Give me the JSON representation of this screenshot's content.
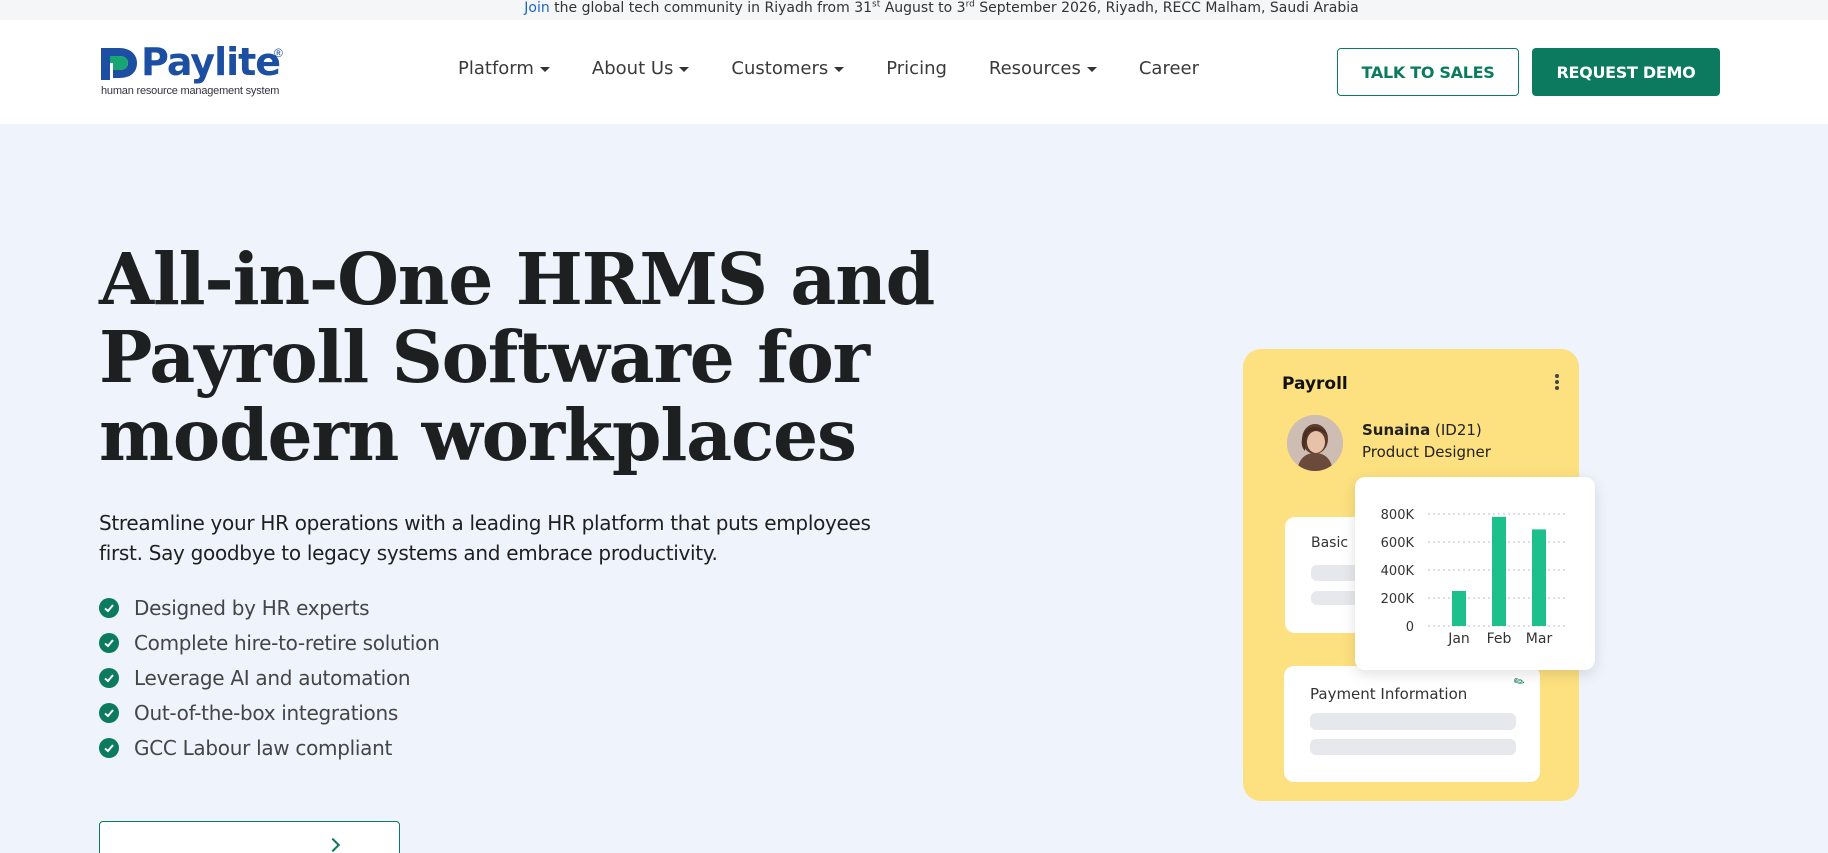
{
  "announcement": {
    "link": "Join",
    "text_a": " the global tech community in Riyadh from 31",
    "sup_a": "st",
    "text_b": " August to 3",
    "sup_b": "rd",
    "text_c": " September 2026, Riyadh, RECC Malham, Saudi Arabia"
  },
  "header": {
    "logo_text": "Paylite",
    "logo_reg": "®",
    "logo_tagline": "human resource management system",
    "nav": [
      {
        "label": "Platform",
        "dropdown": true
      },
      {
        "label": "About Us",
        "dropdown": true
      },
      {
        "label": "Customers",
        "dropdown": true
      },
      {
        "label": "Pricing",
        "dropdown": false
      },
      {
        "label": "Resources",
        "dropdown": true
      },
      {
        "label": "Career",
        "dropdown": false
      }
    ],
    "talk_to_sales": "TALK TO SALES",
    "request_demo": "REQUEST DEMO"
  },
  "hero": {
    "title_line1": "All-in-One HRMS and",
    "title_line2": "Payroll Software for",
    "title_line3": "modern workplaces",
    "subtitle_line1": "Streamline your HR operations with a leading HR platform that puts employees",
    "subtitle_line2": "first. Say goodbye to legacy systems and embrace productivity.",
    "features": [
      "Designed by HR experts",
      "Complete hire-to-retire solution",
      "Leverage AI and automation",
      "Out-of-the-box integrations",
      "GCC Labour law compliant"
    ]
  },
  "payroll_card": {
    "title": "Payroll",
    "employee_name": "Sunaina",
    "employee_id": " (ID21)",
    "employee_role": "Product Designer",
    "basic_label": "Basic",
    "payment_label": "Payment Information"
  },
  "colors": {
    "brand_green": "#0b7a5e",
    "brand_blue": "#1c4fa1",
    "card_yellow": "#fde07f",
    "bar_green": "#1dbf8a",
    "page_bg": "#eef3fc"
  },
  "chart_data": {
    "type": "bar",
    "categories": [
      "Jan",
      "Feb",
      "Mar"
    ],
    "values": [
      250000,
      780000,
      690000
    ],
    "y_ticks": [
      "800K",
      "600K",
      "400K",
      "200K",
      "0"
    ],
    "y_tick_values": [
      800000,
      600000,
      400000,
      200000,
      0
    ],
    "ylim": [
      0,
      800000
    ],
    "grid": true
  }
}
